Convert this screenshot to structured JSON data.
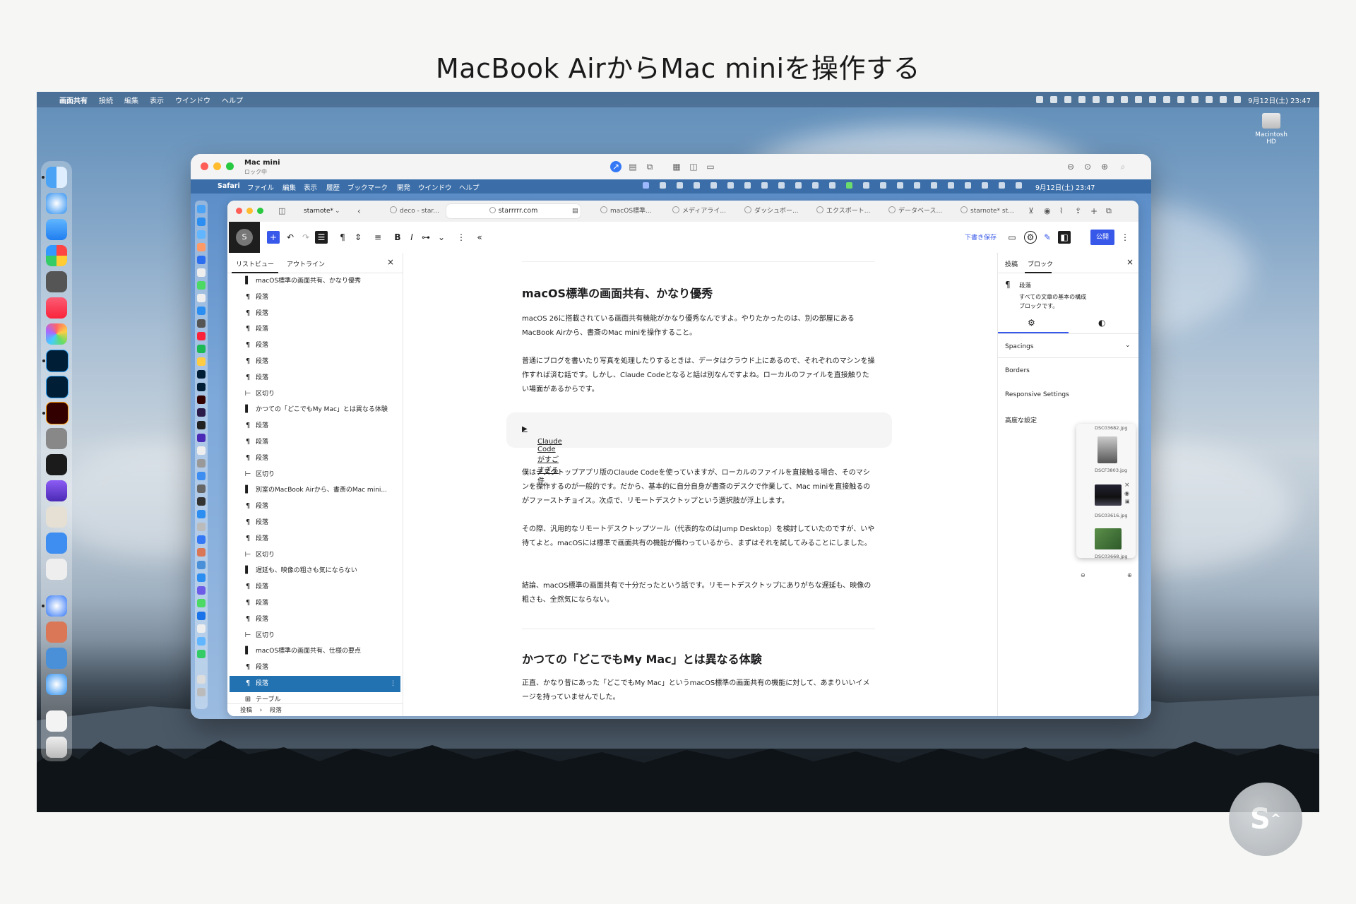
{
  "slide": {
    "title": "MacBook AirからMac miniを操作する"
  },
  "host_menubar": {
    "apple": "",
    "items": [
      "画面共有",
      "接続",
      "編集",
      "表示",
      "ウインドウ",
      "ヘルプ"
    ],
    "clock": "9月12日(土) 23:47"
  },
  "desktop": {
    "drive_label": "Macintosh HD"
  },
  "screen_share_window": {
    "title": "Mac mini",
    "subtitle": "ロック中"
  },
  "remote_menubar": {
    "apple": "",
    "items": [
      "Safari",
      "ファイル",
      "編集",
      "表示",
      "履歴",
      "ブックマーク",
      "開発",
      "ウインドウ",
      "ヘルプ"
    ],
    "clock": "9月12日(土) 23:47"
  },
  "safari": {
    "tab_group": "starnote*",
    "url": "starrrrr.com",
    "tabs": [
      "deco - star...",
      "macOS標準...",
      "メディアライ...",
      "ダッシュボー...",
      "エクスポート...",
      "データベース...",
      "starnote* st..."
    ]
  },
  "editor_toolbar": {
    "logo": "S",
    "save_draft": "下書き保存",
    "publish": "公開"
  },
  "list_view": {
    "tab_list": "リストビュー",
    "tab_outline": "アウトライン",
    "items": [
      {
        "icon": "bookmark",
        "label": "macOS標準の画面共有、かなり優秀"
      },
      {
        "icon": "paragraph",
        "label": "段落"
      },
      {
        "icon": "paragraph",
        "label": "段落"
      },
      {
        "icon": "paragraph",
        "label": "段落"
      },
      {
        "icon": "paragraph",
        "label": "段落"
      },
      {
        "icon": "paragraph",
        "label": "段落"
      },
      {
        "icon": "paragraph",
        "label": "段落"
      },
      {
        "icon": "separator",
        "label": "区切り"
      },
      {
        "icon": "bookmark",
        "label": "かつての「どこでもMy Mac」とは異なる体験"
      },
      {
        "icon": "paragraph",
        "label": "段落"
      },
      {
        "icon": "paragraph",
        "label": "段落"
      },
      {
        "icon": "paragraph",
        "label": "段落"
      },
      {
        "icon": "separator",
        "label": "区切り"
      },
      {
        "icon": "bookmark",
        "label": "別室のMacBook Airから、書斎のMac mini..."
      },
      {
        "icon": "paragraph",
        "label": "段落"
      },
      {
        "icon": "paragraph",
        "label": "段落"
      },
      {
        "icon": "paragraph",
        "label": "段落"
      },
      {
        "icon": "separator",
        "label": "区切り"
      },
      {
        "icon": "bookmark",
        "label": "遅延も、映像の粗さも気にならない"
      },
      {
        "icon": "paragraph",
        "label": "段落"
      },
      {
        "icon": "paragraph",
        "label": "段落"
      },
      {
        "icon": "paragraph",
        "label": "段落"
      },
      {
        "icon": "separator",
        "label": "区切り"
      },
      {
        "icon": "bookmark",
        "label": "macOS標準の画面共有、仕様の要点"
      },
      {
        "icon": "paragraph",
        "label": "段落"
      },
      {
        "icon": "paragraph",
        "label": "段落",
        "selected": true
      },
      {
        "icon": "table",
        "label": "テーブル"
      }
    ],
    "breadcrumb": [
      "投稿",
      "段落"
    ]
  },
  "post": {
    "h2_1": "macOS標準の画面共有、かなり優秀",
    "p1": "macOS 26に搭載されている画面共有機能がかなり優秀なんですよ。やりたかったのは、別の部屋にあるMacBook Airから、書斎のMac miniを操作すること。",
    "p2": "普通にブログを書いたり写真を処理したりするときは、データはクラウド上にあるので、それぞれのマシンを操作すれば済む話です。しかし、Claude Codeとなると話は別なんですよね。ローカルのファイルを直接触りたい場面があるからです。",
    "details": "Claude Codeがすごすぎる件",
    "p3": "僕はデスクトップアプリ版のClaude Codeを使っていますが、ローカルのファイルを直接触る場合、そのマシンを操作するのが一般的です。だから、基本的に自分自身が書斎のデスクで作業して、Mac miniを直接触るのがファーストチョイス。次点で、リモートデスクトップという選択肢が浮上します。",
    "p4": "その際、汎用的なリモートデスクトップツール（代表的なのはJump Desktop）を検討していたのですが、いや待てよと。macOSには標準で画面共有の機能が備わっているから、まずはそれを試してみることにしました。",
    "p5": "結論、macOS標準の画面共有で十分だったという話です。リモートデスクトップにありがちな遅延も、映像の粗さも、全然気にならない。",
    "h2_2": "かつての「どこでもMy Mac」とは異なる体験",
    "p6": "正直、かなり昔にあった「どこでもMy Mac」というmacOS標準の画面共有の機能に対して、あまりいいイメージを持っていませんでした。"
  },
  "settings_sidebar": {
    "tab_post": "投稿",
    "tab_block": "ブロック",
    "block_name": "段落",
    "block_desc": "すべての文章の基本の構成ブロックです。",
    "spacings": "Spacings",
    "borders": "Borders",
    "responsive": "Responsive Settings",
    "advanced": "高度な設定"
  },
  "image_panel": {
    "files": [
      "DSC03682.jpg",
      "DSCF3803.jpg",
      "DSC03616.jpg",
      "DSC03668.jpg"
    ]
  },
  "watermark": "S"
}
